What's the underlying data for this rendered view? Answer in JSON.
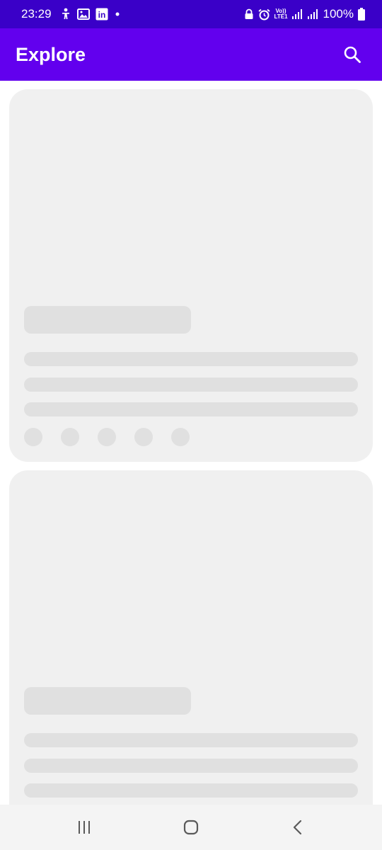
{
  "status_bar": {
    "time": "23:29",
    "battery_text": "100%",
    "volte_top": "Vo))",
    "volte_bottom": "LTE1",
    "left_icons": [
      "accessibility-icon",
      "image-icon",
      "linkedin-icon",
      "notification-dot-icon"
    ],
    "right_icons": [
      "lock-icon",
      "alarm-icon",
      "volte-icon",
      "signal-icon",
      "signal-icon",
      "battery-icon"
    ],
    "linkedin_label": "in"
  },
  "app_bar": {
    "title": "Explore",
    "search_icon": "search-icon"
  },
  "cards": [
    {
      "state": "loading-skeleton",
      "lines": 3,
      "dots": 5
    },
    {
      "state": "loading-skeleton",
      "lines": 3,
      "dots": 0
    }
  ],
  "nav_bar": {
    "icons": [
      "recents-icon",
      "home-icon",
      "back-icon"
    ]
  },
  "colors": {
    "status_bar": "#3a00c8",
    "app_bar": "#6200ee",
    "card_bg": "#f0f0f0",
    "skeleton": "#e0e0e0",
    "nav_bar": "#f4f4f4"
  }
}
